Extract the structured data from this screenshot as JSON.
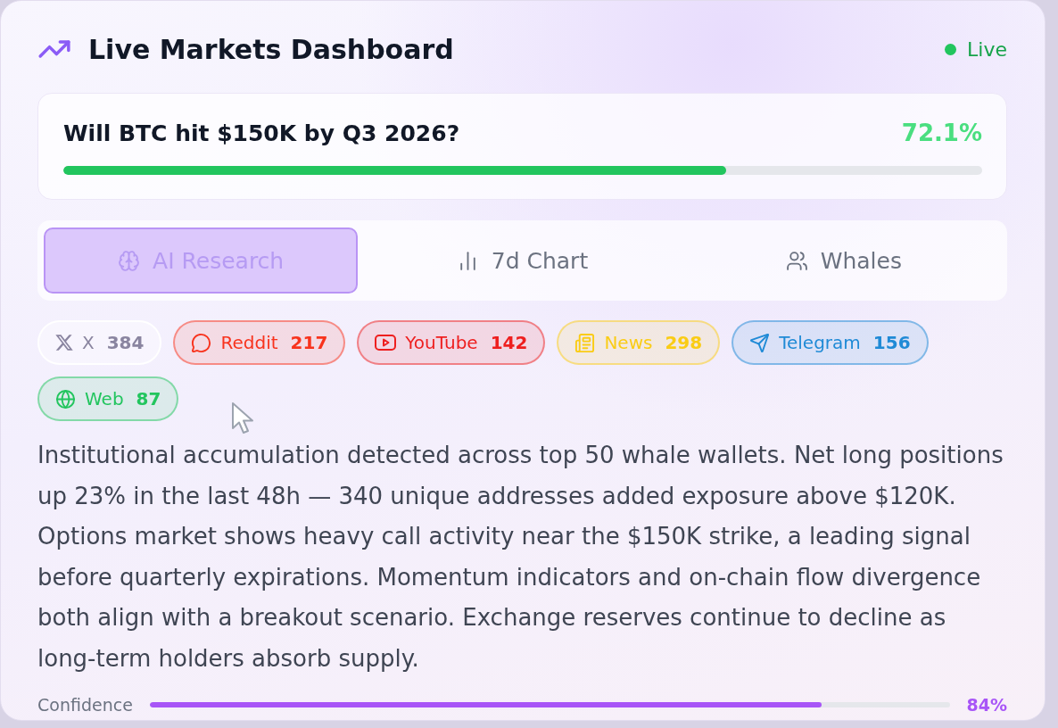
{
  "header": {
    "title": "Live Markets Dashboard",
    "status": "Live"
  },
  "market": {
    "question": "Will BTC hit $150K by Q3 2026?",
    "probability": "72.1%",
    "level": 0.721
  },
  "tabs": [
    {
      "kind": "research",
      "label": "AI Research",
      "selected": true
    },
    {
      "kind": "chart",
      "label": "7d Chart",
      "selected": false
    },
    {
      "kind": "whales",
      "label": "Whales",
      "selected": false
    }
  ],
  "sources": [
    {
      "kind": "x",
      "name": "X",
      "count": "384",
      "color": "#ffffff"
    },
    {
      "kind": "reddit",
      "name": "Reddit",
      "count": "217",
      "color": "#f8331d"
    },
    {
      "kind": "youtube",
      "name": "YouTube",
      "count": "142",
      "color": "#ee1f1f"
    },
    {
      "kind": "news",
      "name": "News",
      "count": "298",
      "color": "#facc15"
    },
    {
      "kind": "telegram",
      "name": "Telegram",
      "count": "156",
      "color": "#1f8ad6"
    },
    {
      "kind": "web",
      "name": "Web",
      "count": "87",
      "color": "#22c55e"
    }
  ],
  "summary": "Institutional accumulation detected across top 50 whale wallets. Net long positions up 23% in the last 48h — 340 unique addresses added exposure above $120K. Options market shows heavy call activity near the $150K strike, a leading signal before quarterly expirations. Momentum indicators and on-chain flow divergence both align with a breakout scenario. Exchange reserves continue to decline as long-term holders absorb supply.",
  "confidence": {
    "label": "Confidence",
    "level": 0.84,
    "reading": "84%"
  }
}
